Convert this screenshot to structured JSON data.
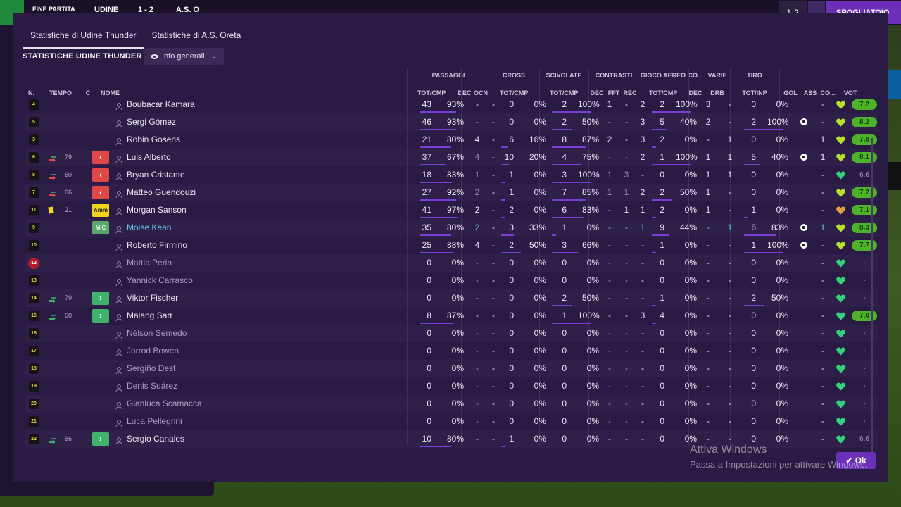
{
  "scoreboard": {
    "status": "FINE PARTITA",
    "home": "UDINE",
    "score": "1 - 2",
    "away": "A.S. O",
    "small_score": "1-2",
    "right_button": "SPOGLIATOIO"
  },
  "tabs": [
    "Statistiche di Udine Thunder",
    "Statistiche di A.S. Oreta"
  ],
  "section_title": "STATISTICHE UDINE THUNDER",
  "view_dropdown": "Info generali",
  "group_headers": [
    "PASSAGGI",
    "CROSS",
    "SCIVOLATE",
    "CONTRASTI",
    "GIOCO AEREO",
    "CO...",
    "VARIE",
    "TIRO"
  ],
  "columns": [
    "N.",
    "TEMPO",
    "C",
    "NOME",
    "TOT/CMP",
    "DEC",
    "OCN",
    "TOT/CMP",
    "TOT/CMP",
    "DEC",
    "FFT",
    "REC",
    "TOT/CMP",
    "DEC",
    "DRB",
    "TOT/INP",
    "GOL",
    "ASS",
    "CO...",
    "VOT"
  ],
  "rows": [
    {
      "n": "4",
      "time": "",
      "sub": "",
      "cap": "",
      "name": "Boubacar Kamara",
      "p": "43",
      "pp": "93%",
      "pdec": "-",
      "ocn": "-",
      "c": "0",
      "cp": "0%",
      "s": "2",
      "sp": "100%",
      "cdec": "1",
      "fft": "-",
      "rec": "2",
      "a": "2",
      "ap": "100%",
      "co": "3",
      "drb": "-",
      "t": "0",
      "tp": "0%",
      "gol": "",
      "ass": "-",
      "vote": "7.2",
      "vgood": true,
      "dim": false
    },
    {
      "n": "5",
      "time": "",
      "sub": "",
      "cap": "",
      "name": "Sergi Gómez",
      "p": "46",
      "pp": "93%",
      "pdec": "-",
      "ocn": "-",
      "c": "0",
      "cp": "0%",
      "s": "2",
      "sp": "50%",
      "cdec": "-",
      "fft": "-",
      "rec": "3",
      "a": "5",
      "ap": "40%",
      "co": "2",
      "drb": "-",
      "t": "2",
      "tp": "100%",
      "gol": "ball",
      "ass": "-",
      "vote": "8.2",
      "vgood": true,
      "dim": false
    },
    {
      "n": "3",
      "time": "",
      "sub": "",
      "cap": "",
      "name": "Robin Gosens",
      "p": "21",
      "pp": "80%",
      "pdec": "4",
      "ocn": "-",
      "c": "6",
      "cp": "16%",
      "s": "8",
      "sp": "87%",
      "cdec": "2",
      "fft": "-",
      "rec": "3",
      "a": "2",
      "ap": "0%",
      "co": "-",
      "drb": "1",
      "t": "0",
      "tp": "0%",
      "gol": "",
      "ass": "1",
      "vote": "7.8",
      "vgood": true,
      "dim": false
    },
    {
      "n": "6",
      "time": "79",
      "sub": "out",
      "cap": "out",
      "name": "Luis Alberto",
      "p": "37",
      "pp": "67%",
      "pdec": "4",
      "ocn": "-",
      "c": "10",
      "cp": "20%",
      "s": "4",
      "sp": "75%",
      "cdec": "-",
      "fft": "-",
      "rec": "2",
      "a": "1",
      "ap": "100%",
      "co": "1",
      "drb": "1",
      "t": "5",
      "tp": "40%",
      "gol": "ball",
      "ass": "1",
      "vote": "8.1",
      "vgood": true,
      "dim": true
    },
    {
      "n": "8",
      "time": "60",
      "sub": "out",
      "cap": "out",
      "name": "Bryan Cristante",
      "p": "18",
      "pp": "83%",
      "pdec": "1",
      "ocn": "-",
      "c": "1",
      "cp": "0%",
      "s": "3",
      "sp": "100%",
      "cdec": "1",
      "fft": "3",
      "rec": "-",
      "a": "0",
      "ap": "0%",
      "co": "1",
      "drb": "1",
      "t": "0",
      "tp": "0%",
      "gol": "",
      "ass": "-",
      "vote": "6.6",
      "vgood": false,
      "dim": true
    },
    {
      "n": "7",
      "time": "66",
      "sub": "out",
      "cap": "out",
      "name": "Matteo Guendouzi",
      "p": "27",
      "pp": "92%",
      "pdec": "2",
      "ocn": "-",
      "c": "1",
      "cp": "0%",
      "s": "7",
      "sp": "85%",
      "cdec": "1",
      "fft": "1",
      "rec": "2",
      "a": "2",
      "ap": "50%",
      "co": "1",
      "drb": "-",
      "t": "0",
      "tp": "0%",
      "gol": "",
      "ass": "-",
      "vote": "7.2",
      "vgood": true,
      "dim": true
    },
    {
      "n": "11",
      "time": "21",
      "sub": "yellow",
      "cap": "amm",
      "name": "Morgan Sanson",
      "p": "41",
      "pp": "97%",
      "pdec": "2",
      "ocn": "-",
      "c": "2",
      "cp": "0%",
      "s": "6",
      "sp": "83%",
      "cdec": "-",
      "fft": "1",
      "rec": "1",
      "a": "2",
      "ap": "0%",
      "co": "1",
      "drb": "-",
      "t": "1",
      "tp": "0%",
      "gol": "",
      "ass": "-",
      "vote": "7.1",
      "vgood": true,
      "dim": false
    },
    {
      "n": "9",
      "time": "",
      "sub": "",
      "cap": "mic",
      "name": "Moise Kean",
      "p": "35",
      "pp": "80%",
      "pdec": "2",
      "ocn": "-",
      "c": "3",
      "cp": "33%",
      "s": "1",
      "sp": "0%",
      "cdec": "-",
      "fft": "-",
      "rec": "1",
      "a": "9",
      "ap": "44%",
      "co": "-",
      "drb": "1",
      "t": "6",
      "tp": "83%",
      "gol": "ball",
      "ass": "1",
      "vote": "8.3",
      "vgood": true,
      "dim": false,
      "blue": true
    },
    {
      "n": "10",
      "time": "",
      "sub": "",
      "cap": "",
      "name": "Roberto Firmino",
      "p": "25",
      "pp": "88%",
      "pdec": "4",
      "ocn": "-",
      "c": "2",
      "cp": "50%",
      "s": "3",
      "sp": "66%",
      "cdec": "-",
      "fft": "-",
      "rec": "-",
      "a": "1",
      "ap": "0%",
      "co": "-",
      "drb": "-",
      "t": "1",
      "tp": "100%",
      "gol": "ball",
      "ass": "-",
      "vote": "7.7",
      "vgood": true,
      "dim": false
    },
    {
      "n": "12",
      "time": "",
      "sub": "",
      "cap": "",
      "name": "Mattia Perin",
      "p": "0",
      "pp": "0%",
      "pdec": "-",
      "ocn": "-",
      "c": "0",
      "cp": "0%",
      "s": "0",
      "sp": "0%",
      "cdec": "-",
      "fft": "-",
      "rec": "-",
      "a": "0",
      "ap": "0%",
      "co": "-",
      "drb": "-",
      "t": "0",
      "tp": "0%",
      "gol": "",
      "ass": "-",
      "vote": "-",
      "vgood": false,
      "dim": true,
      "gk": true
    },
    {
      "n": "13",
      "time": "",
      "sub": "",
      "cap": "",
      "name": "Yannick Carrasco",
      "p": "0",
      "pp": "0%",
      "pdec": "-",
      "ocn": "-",
      "c": "0",
      "cp": "0%",
      "s": "0",
      "sp": "0%",
      "cdec": "-",
      "fft": "-",
      "rec": "-",
      "a": "0",
      "ap": "0%",
      "co": "-",
      "drb": "-",
      "t": "0",
      "tp": "0%",
      "gol": "",
      "ass": "-",
      "vote": "-",
      "vgood": false,
      "dim": true
    },
    {
      "n": "14",
      "time": "79",
      "sub": "in",
      "cap": "in",
      "name": "Viktor Fischer",
      "p": "0",
      "pp": "0%",
      "pdec": "-",
      "ocn": "-",
      "c": "0",
      "cp": "0%",
      "s": "2",
      "sp": "50%",
      "cdec": "-",
      "fft": "-",
      "rec": "-",
      "a": "1",
      "ap": "0%",
      "co": "-",
      "drb": "-",
      "t": "2",
      "tp": "50%",
      "gol": "",
      "ass": "-",
      "vote": "-",
      "vgood": false,
      "dim": false
    },
    {
      "n": "15",
      "time": "60",
      "sub": "in",
      "cap": "in",
      "name": "Malang Sarr",
      "p": "8",
      "pp": "87%",
      "pdec": "-",
      "ocn": "-",
      "c": "0",
      "cp": "0%",
      "s": "1",
      "sp": "100%",
      "cdec": "-",
      "fft": "-",
      "rec": "3",
      "a": "4",
      "ap": "0%",
      "co": "-",
      "drb": "-",
      "t": "0",
      "tp": "0%",
      "gol": "",
      "ass": "-",
      "vote": "7.0",
      "vgood": true,
      "dim": false
    },
    {
      "n": "16",
      "time": "",
      "sub": "",
      "cap": "",
      "name": "Nélson Semedo",
      "p": "0",
      "pp": "0%",
      "pdec": "-",
      "ocn": "-",
      "c": "0",
      "cp": "0%",
      "s": "0",
      "sp": "0%",
      "cdec": "-",
      "fft": "-",
      "rec": "-",
      "a": "0",
      "ap": "0%",
      "co": "-",
      "drb": "-",
      "t": "0",
      "tp": "0%",
      "gol": "",
      "ass": "-",
      "vote": "-",
      "vgood": false,
      "dim": true
    },
    {
      "n": "17",
      "time": "",
      "sub": "",
      "cap": "",
      "name": "Jarrod Bowen",
      "p": "0",
      "pp": "0%",
      "pdec": "-",
      "ocn": "-",
      "c": "0",
      "cp": "0%",
      "s": "0",
      "sp": "0%",
      "cdec": "-",
      "fft": "-",
      "rec": "-",
      "a": "0",
      "ap": "0%",
      "co": "-",
      "drb": "-",
      "t": "0",
      "tp": "0%",
      "gol": "",
      "ass": "-",
      "vote": "-",
      "vgood": false,
      "dim": true
    },
    {
      "n": "18",
      "time": "",
      "sub": "",
      "cap": "",
      "name": "Sergiño Dest",
      "p": "0",
      "pp": "0%",
      "pdec": "-",
      "ocn": "-",
      "c": "0",
      "cp": "0%",
      "s": "0",
      "sp": "0%",
      "cdec": "-",
      "fft": "-",
      "rec": "-",
      "a": "0",
      "ap": "0%",
      "co": "-",
      "drb": "-",
      "t": "0",
      "tp": "0%",
      "gol": "",
      "ass": "-",
      "vote": "-",
      "vgood": false,
      "dim": true
    },
    {
      "n": "19",
      "time": "",
      "sub": "",
      "cap": "",
      "name": "Denis Suárez",
      "p": "0",
      "pp": "0%",
      "pdec": "-",
      "ocn": "-",
      "c": "0",
      "cp": "0%",
      "s": "0",
      "sp": "0%",
      "cdec": "-",
      "fft": "-",
      "rec": "-",
      "a": "0",
      "ap": "0%",
      "co": "-",
      "drb": "-",
      "t": "0",
      "tp": "0%",
      "gol": "",
      "ass": "-",
      "vote": "-",
      "vgood": false,
      "dim": true
    },
    {
      "n": "20",
      "time": "",
      "sub": "",
      "cap": "",
      "name": "Gianluca Scamacca",
      "p": "0",
      "pp": "0%",
      "pdec": "-",
      "ocn": "-",
      "c": "0",
      "cp": "0%",
      "s": "0",
      "sp": "0%",
      "cdec": "-",
      "fft": "-",
      "rec": "-",
      "a": "0",
      "ap": "0%",
      "co": "-",
      "drb": "-",
      "t": "0",
      "tp": "0%",
      "gol": "",
      "ass": "-",
      "vote": "-",
      "vgood": false,
      "dim": true
    },
    {
      "n": "21",
      "time": "",
      "sub": "",
      "cap": "",
      "name": "Luca Pellegrini",
      "p": "0",
      "pp": "0%",
      "pdec": "-",
      "ocn": "-",
      "c": "0",
      "cp": "0%",
      "s": "0",
      "sp": "0%",
      "cdec": "-",
      "fft": "-",
      "rec": "-",
      "a": "0",
      "ap": "0%",
      "co": "-",
      "drb": "-",
      "t": "0",
      "tp": "0%",
      "gol": "",
      "ass": "-",
      "vote": "-",
      "vgood": false,
      "dim": true
    },
    {
      "n": "22",
      "time": "66",
      "sub": "in",
      "cap": "in",
      "name": "Sergio Canales",
      "p": "10",
      "pp": "80%",
      "pdec": "-",
      "ocn": "-",
      "c": "1",
      "cp": "0%",
      "s": "0",
      "sp": "0%",
      "cdec": "-",
      "fft": "-",
      "rec": "-",
      "a": "0",
      "ap": "0%",
      "co": "-",
      "drb": "-",
      "t": "0",
      "tp": "0%",
      "gol": "",
      "ass": "-",
      "vote": "6.6",
      "vgood": false,
      "dim": false
    }
  ],
  "ok_label": "Ok",
  "watermark": {
    "line1": "Attiva Windows",
    "line2": "Passa a Impostazioni per attivare Windows."
  },
  "colors": {
    "accent": "#6b2fb8",
    "good_vote": "#4db32a",
    "bar": "#7a3ed6"
  }
}
